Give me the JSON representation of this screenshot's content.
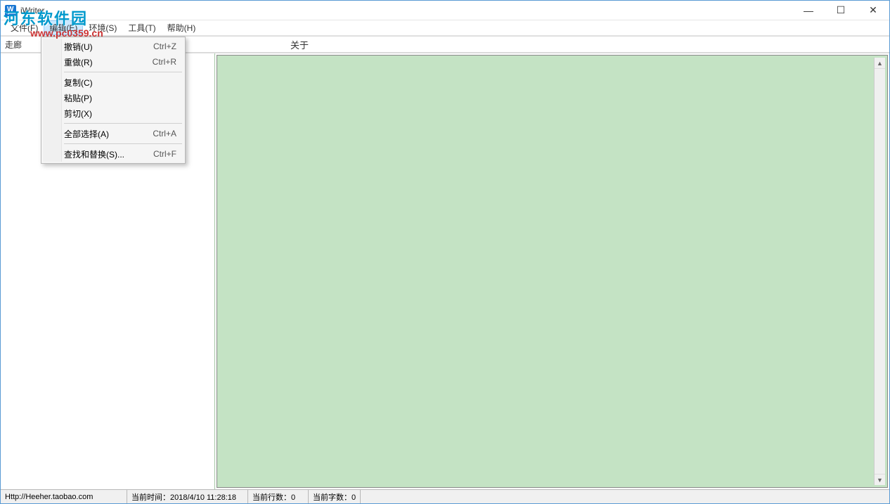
{
  "titlebar": {
    "app_name": "iWriter",
    "min_glyph": "—",
    "max_glyph": "☐",
    "close_glyph": "✕"
  },
  "watermark": {
    "line1": "河东软件园",
    "line2": "www.pc0359.cn"
  },
  "menubar": {
    "items": [
      {
        "label": "文件(F)"
      },
      {
        "label": "编辑(E)"
      },
      {
        "label": "环境(S)"
      },
      {
        "label": "工具(T)"
      },
      {
        "label": "帮助(H)"
      }
    ]
  },
  "toolbar": {
    "left_hint": "走廊",
    "center_label": "关于"
  },
  "dropdown": {
    "items": [
      {
        "label": "撤销(U)",
        "shortcut": "Ctrl+Z"
      },
      {
        "label": "重做(R)",
        "shortcut": "Ctrl+R"
      },
      {
        "sep": true
      },
      {
        "label": "复制(C)",
        "shortcut": ""
      },
      {
        "label": "粘贴(P)",
        "shortcut": ""
      },
      {
        "label": "剪切(X)",
        "shortcut": ""
      },
      {
        "sep": true
      },
      {
        "label": "全部选择(A)",
        "shortcut": "Ctrl+A"
      },
      {
        "sep": true
      },
      {
        "label": "查找和替换(S)...",
        "shortcut": "Ctrl+F"
      }
    ]
  },
  "statusbar": {
    "url": "Http://Heeher.taobao.com",
    "time_label": "当前时间：2018/4/10 11:28:18",
    "line_label": "当前行数：0",
    "chars_label": "当前字数：0"
  }
}
